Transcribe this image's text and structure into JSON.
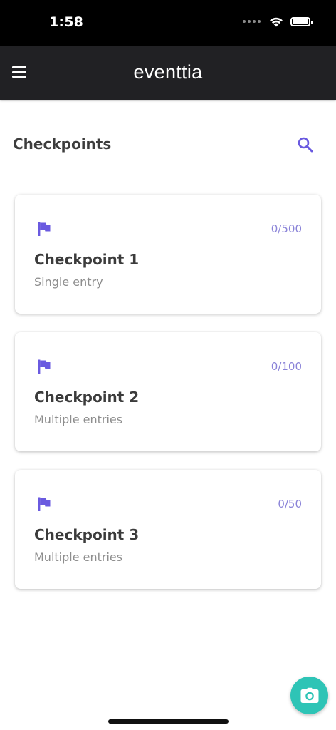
{
  "status_bar": {
    "time": "1:58"
  },
  "header": {
    "brand": "eventtia"
  },
  "page": {
    "title": "Checkpoints"
  },
  "checkpoints": [
    {
      "name": "Checkpoint 1",
      "type": "Single entry",
      "count": "0/500"
    },
    {
      "name": "Checkpoint 2",
      "type": "Multiple entries",
      "count": "0/100"
    },
    {
      "name": "Checkpoint 3",
      "type": "Multiple entries",
      "count": "0/50"
    }
  ],
  "icons": {
    "menu": "hamburger-menu-icon",
    "search": "search-icon",
    "checkpoint": "flag-icon",
    "scan": "camera-icon"
  },
  "colors": {
    "accent": "#6a5ae0",
    "count": "#8a83d8",
    "fab": "#2ec4b6",
    "header_bg": "#212124"
  }
}
